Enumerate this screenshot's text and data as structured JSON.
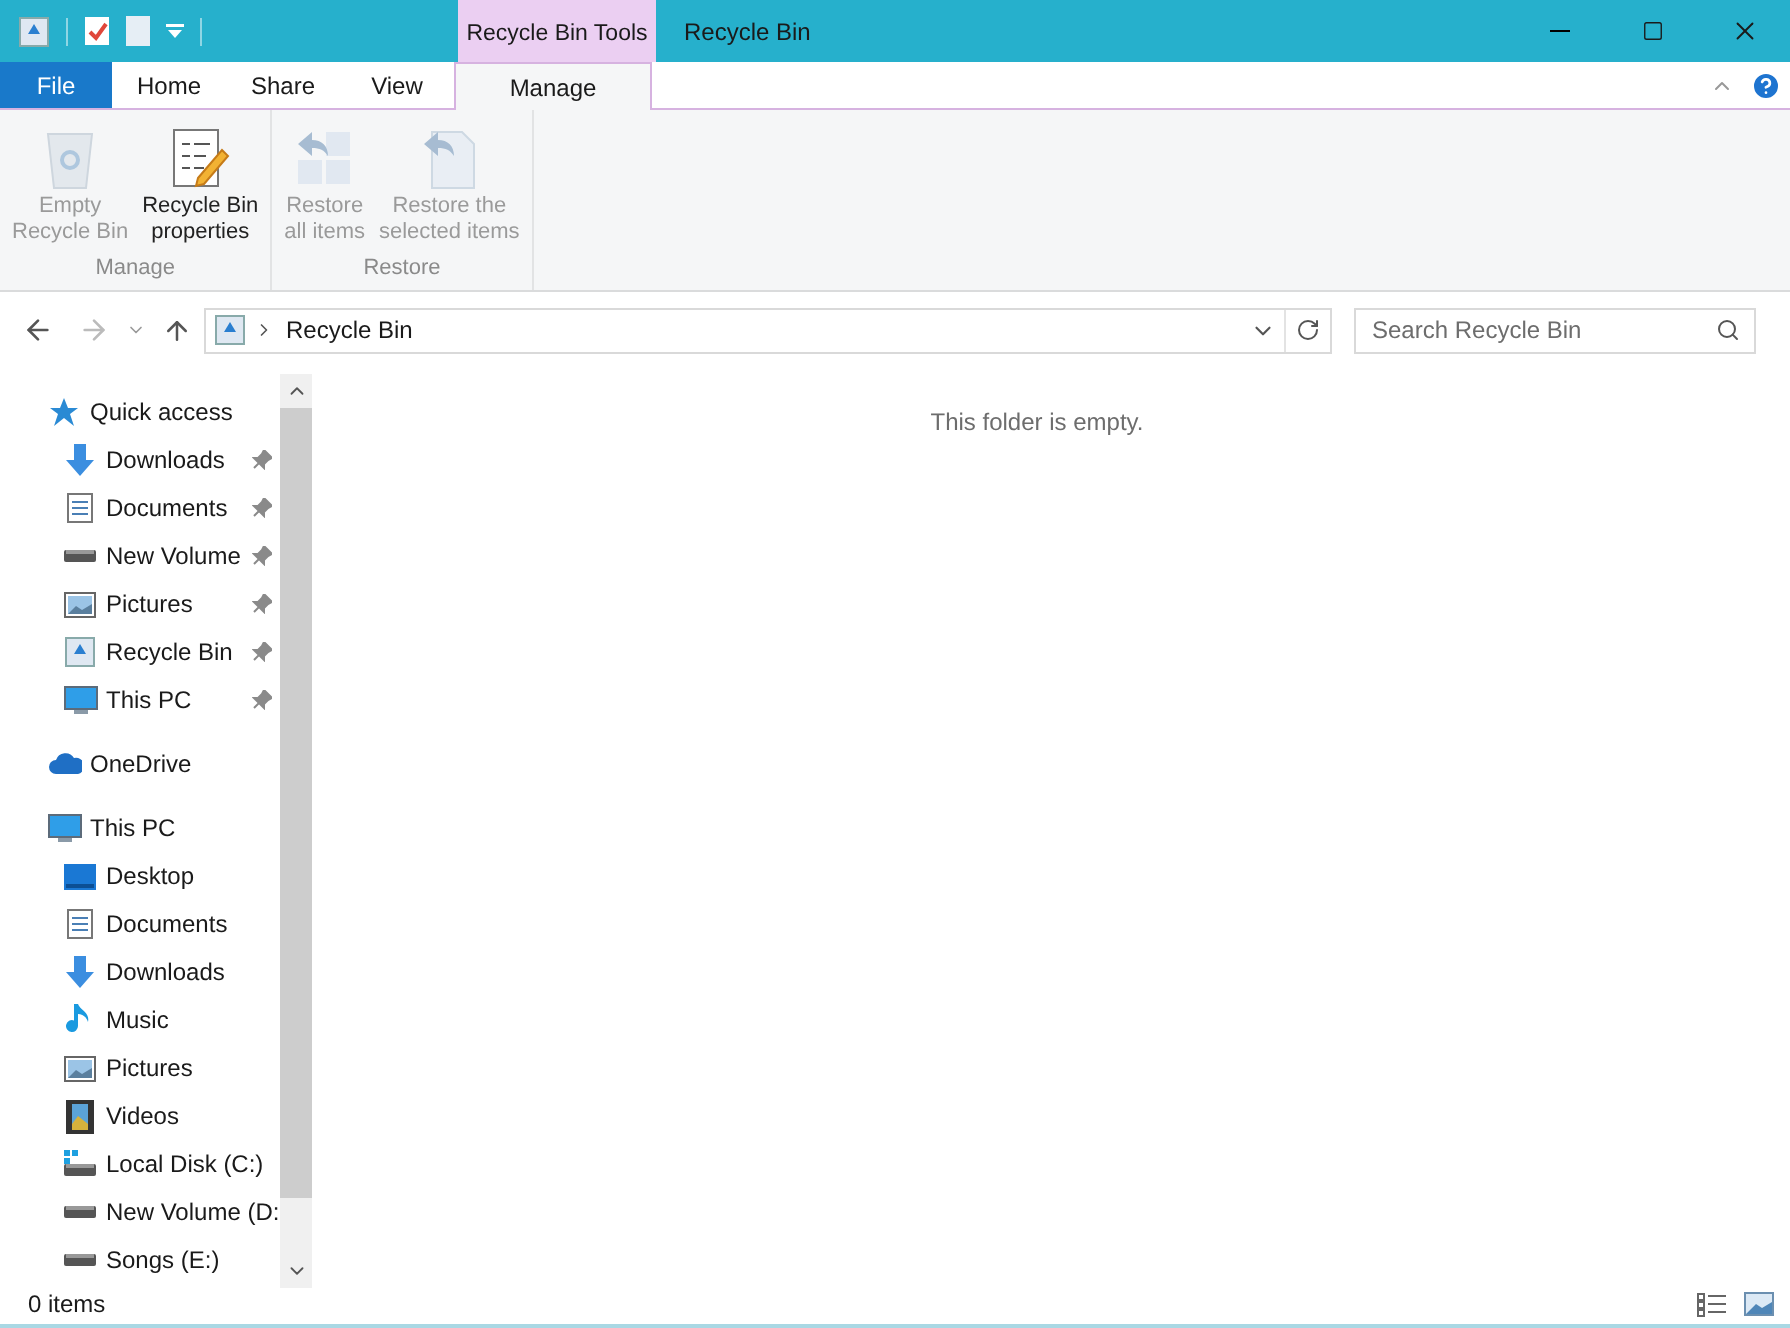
{
  "title_bar": {
    "contextual_tab": "Recycle Bin Tools",
    "title": "Recycle Bin"
  },
  "ribbon_tabs": [
    {
      "label": "File",
      "kind": "file",
      "selected": false
    },
    {
      "label": "Home",
      "kind": "tab",
      "selected": false
    },
    {
      "label": "Share",
      "kind": "tab",
      "selected": false
    },
    {
      "label": "View",
      "kind": "tab",
      "selected": false
    },
    {
      "label": "Manage",
      "kind": "tab",
      "selected": true
    }
  ],
  "ribbon_groups": [
    {
      "label": "Manage",
      "commands": [
        {
          "label": "Empty\nRecycle Bin",
          "kind": "bin",
          "disabled": true
        },
        {
          "label": "Recycle Bin\nproperties",
          "kind": "properties",
          "disabled": false
        }
      ]
    },
    {
      "label": "Restore",
      "commands": [
        {
          "label": "Restore\nall items",
          "kind": "restore-all",
          "disabled": true
        },
        {
          "label": "Restore the\nselected items",
          "kind": "restore-selected",
          "disabled": true
        }
      ]
    }
  ],
  "address_bar": {
    "path": "Recycle Bin"
  },
  "search": {
    "placeholder": "Search Recycle Bin"
  },
  "navigation": [
    {
      "label": "Quick access",
      "kind": "star",
      "children": [
        {
          "label": "Downloads",
          "kind": "download",
          "pinned": true
        },
        {
          "label": "Documents",
          "kind": "document",
          "pinned": true
        },
        {
          "label": "New Volume",
          "kind": "drive",
          "pinned": true
        },
        {
          "label": "Pictures",
          "kind": "pictures",
          "pinned": true
        },
        {
          "label": "Recycle Bin",
          "kind": "bin",
          "pinned": true
        },
        {
          "label": "This PC",
          "kind": "pc",
          "pinned": true
        }
      ]
    },
    {
      "label": "OneDrive",
      "kind": "cloud"
    },
    {
      "label": "This PC",
      "kind": "pc",
      "children": [
        {
          "label": "Desktop",
          "kind": "desktop",
          "pinned": false
        },
        {
          "label": "Documents",
          "kind": "document",
          "pinned": false
        },
        {
          "label": "Downloads",
          "kind": "download",
          "pinned": false
        },
        {
          "label": "Music",
          "kind": "music",
          "pinned": false
        },
        {
          "label": "Pictures",
          "kind": "pictures",
          "pinned": false
        },
        {
          "label": "Videos",
          "kind": "video",
          "pinned": false
        },
        {
          "label": "Local Disk (C:)",
          "kind": "system-drive",
          "pinned": false
        },
        {
          "label": "New Volume (D:",
          "kind": "drive",
          "pinned": false
        },
        {
          "label": "Songs (E:)",
          "kind": "drive",
          "pinned": false
        }
      ]
    }
  ],
  "content": {
    "empty_message": "This folder is empty."
  },
  "status_bar": {
    "item_count": "0 items"
  }
}
